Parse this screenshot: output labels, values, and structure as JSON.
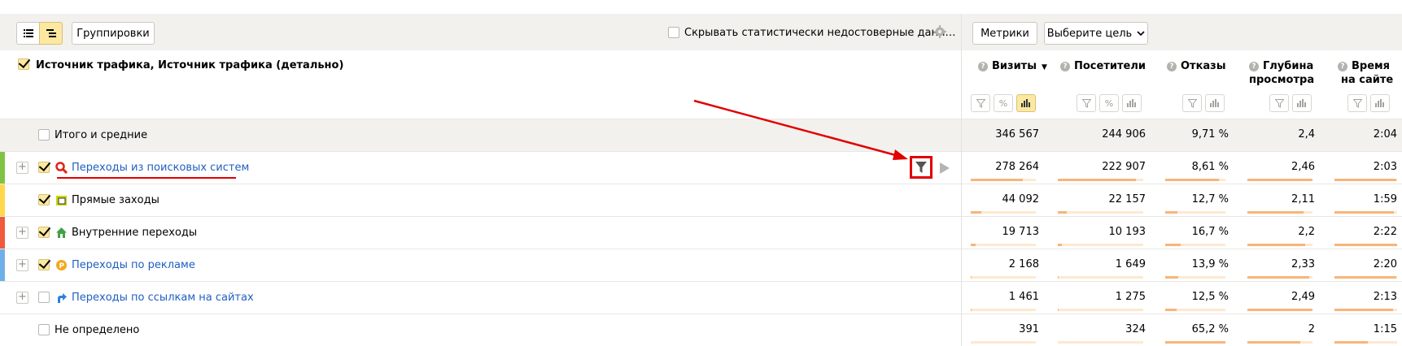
{
  "toolbar": {
    "view_list_icon": "list-icon",
    "view_tree_icon": "tree-icon",
    "groupings_label": "Группировки",
    "hide_unreliable_label": "Скрывать статистически недостоверные данн…",
    "metrics_label": "Метрики",
    "goal_label": "Выберите цель"
  },
  "dimension_header": "Источник трафика, Источник трафика (детально)",
  "columns": [
    {
      "label": "Визиты",
      "label2": "",
      "sort": "▼"
    },
    {
      "label": "Посетители",
      "label2": "",
      "sort": ""
    },
    {
      "label": "Отказы",
      "label2": "",
      "sort": ""
    },
    {
      "label": "Глубина",
      "label2": "просмотра",
      "sort": ""
    },
    {
      "label": "Время",
      "label2": "на сайте",
      "sort": ""
    }
  ],
  "rows": [
    {
      "label": "Итого и средние",
      "values": [
        "346 567",
        "244 906",
        "9,71 %",
        "2,4",
        "2:04"
      ]
    },
    {
      "label": "Переходы из поисковых систем",
      "values": [
        "278 264",
        "222 907",
        "8,61 %",
        "2,46",
        "2:03"
      ],
      "share": [
        0.8,
        0.91,
        0.89,
        1.0,
        0.99
      ]
    },
    {
      "label": "Прямые заходы",
      "values": [
        "44 092",
        "22 157",
        "12,7 %",
        "2,11",
        "1:59"
      ],
      "share": [
        0.16,
        0.1,
        0.2,
        0.86,
        0.95
      ]
    },
    {
      "label": "Внутренние переходы",
      "values": [
        "19 713",
        "10 193",
        "16,7 %",
        "2,2",
        "2:22"
      ],
      "share": [
        0.07,
        0.05,
        0.26,
        0.89,
        1.0
      ]
    },
    {
      "label": "Переходы по рекламе",
      "values": [
        "2 168",
        "1 649",
        "13,9 %",
        "2,33",
        "2:20"
      ],
      "share": [
        0.01,
        0.01,
        0.21,
        0.95,
        0.99
      ]
    },
    {
      "label": "Переходы по ссылкам на сайтах",
      "values": [
        "1 461",
        "1 275",
        "12,5 %",
        "2,49",
        "2:13"
      ],
      "share": [
        0.01,
        0.01,
        0.19,
        1.0,
        0.94
      ]
    },
    {
      "label": "Не определено",
      "values": [
        "391",
        "324",
        "65,2 %",
        "2",
        "1:15"
      ],
      "share": [
        0.0,
        0.0,
        1.0,
        0.81,
        0.53
      ]
    }
  ],
  "colors": {
    "accent_yellow": "#fce8a0",
    "link": "#1f5fc2",
    "annotation_red": "#e00000",
    "search_bar": "#80c342",
    "direct_bar": "#ffd84d",
    "internal_bar": "#f05b3b",
    "ads_bar": "#6fb0e8"
  }
}
